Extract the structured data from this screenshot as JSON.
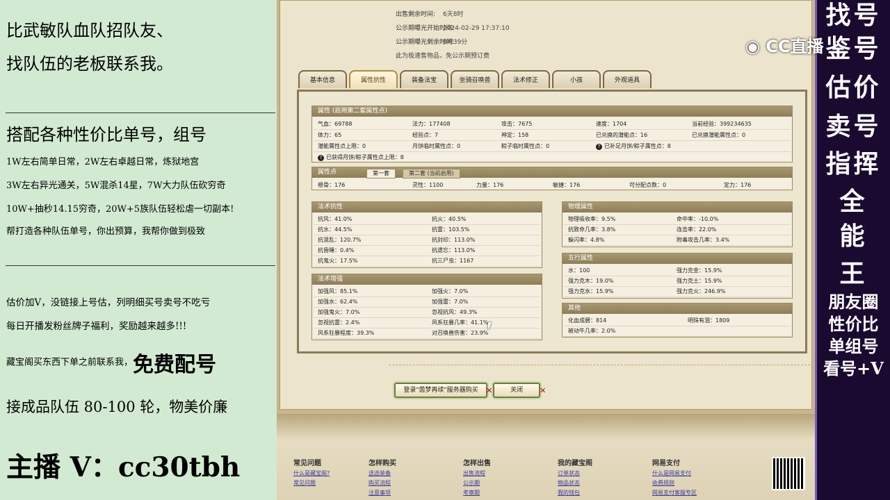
{
  "left_panel": {
    "line1": "比武敏队血队招队友、",
    "line2": "找队伍的老板联系我。",
    "heading2": "搭配各种性价比单号，组号",
    "p1": "1W左右简单日常，2W左右卓越日常，炼狱地宫",
    "p2": "3W左右异光通关，5W混杀14星，7W大力队伍砍穷奇",
    "p3": "10W+抽秒14.15穷奇，20W+5族队伍轻松虐一切副本!",
    "p4": "帮打造各种队伍单号，你出预算，我帮你做到极致",
    "p5": "估价加V，没链接上号估，列明细买号卖号不吃亏",
    "p6": "每日开播发粉丝牌子福利，奖励越来越多!!!",
    "p7a": "藏宝阁买东西下单之前联系我，",
    "p7b": "免费配号",
    "p8": "接成品队伍 80-100 轮，物美价廉",
    "contact": "主播 V：cc30tbh"
  },
  "right_panel": {
    "big": [
      "找号",
      "鉴号",
      "估价",
      "卖号",
      "指挥",
      "全",
      "能",
      "王"
    ],
    "small": [
      "朋友圈",
      "性价比",
      "单组号",
      "看号+V"
    ]
  },
  "logo": "CC直播",
  "top_info": [
    {
      "label": "出售剩余时间:",
      "value": "6天8时"
    },
    {
      "label": "公示期曝光开始时间:",
      "value": "2024-02-29 17:37:10"
    },
    {
      "label": "公示期曝光剩余时间:",
      "value": "8时39分"
    },
    {
      "label": "此为极速售物品，免公示期预订费",
      "value": ""
    }
  ],
  "tabs": [
    "基本信息",
    "属性抗性",
    "装备法宝",
    "坐骑召唤兽",
    "法术修正",
    "小孩",
    "外观道具"
  ],
  "attr_section": {
    "header": "属性 (启用第二套属性点)",
    "rows": [
      [
        "气血：69788",
        "法力：177408",
        "攻击：7675",
        "速度：1704",
        "当前经验：399234635"
      ],
      [
        "体力：65",
        "经验点：7",
        "神定：158",
        "已兑换的潜能点：16",
        "已兑换潜能属性点：0"
      ],
      [
        "潜能属性点上限：0",
        "月饼临时属性点：0",
        "粽子临时属性点：0",
        "已补足月饼/粽子属性点：8",
        ""
      ],
      [
        "已获得月饼/粽子属性点上限：8",
        "",
        "",
        "",
        ""
      ]
    ]
  },
  "points_section": {
    "header": "属性点",
    "tab1": "第一套",
    "tab2": "第二套 (当前启用)",
    "row": [
      "根骨：176",
      "灵性：1100",
      "力量：176",
      "敏捷：176",
      "可分配点数：0",
      "定力：176"
    ]
  },
  "resist_section": {
    "header": "法术抗性",
    "rows": [
      [
        "抗风：41.0%",
        "抗火：40.5%"
      ],
      [
        "抗水：44.5%",
        "抗雷：103.5%"
      ],
      [
        "抗混乱：120.7%",
        "抗封印：113.0%"
      ],
      [
        "抗昏睡：0.4%",
        "抗遗忘：113.0%"
      ],
      [
        "抗鬼火：17.5%",
        "抗三尸虫：1167"
      ]
    ]
  },
  "enhance_section": {
    "header": "法术增强",
    "rows": [
      [
        "加强风：85.1%",
        "加强火：7.0%"
      ],
      [
        "加强水：62.4%",
        "加强雷：7.0%"
      ],
      [
        "加强鬼火：7.0%",
        "忽视抗风：49.3%"
      ],
      [
        "忽视抗雷：2.4%",
        "风系狂暴几率：41.1%"
      ],
      [
        "风系狂暴程度：39.3%",
        "对召唤兽伤害：23.9%"
      ]
    ]
  },
  "physical_section": {
    "header": "物理属性",
    "rows": [
      [
        "物理吸收率：9.5%",
        "命中率：-10.0%"
      ],
      [
        "抗致命几率：3.8%",
        "连击率：22.0%"
      ],
      [
        "躲闪率：4.8%",
        "附毒攻击几率：3.4%"
      ]
    ]
  },
  "wuxing_section": {
    "header": "五行属性",
    "rows": [
      [
        "水：100",
        "强力克金：15.9%"
      ],
      [
        "强力克木：19.0%",
        "强力克土：15.9%"
      ],
      [
        "强力克水：15.9%",
        "强力克火：246.9%"
      ]
    ]
  },
  "other_section": {
    "header": "其他",
    "rows": [
      [
        "化血成碧：814",
        "明珠有泪：1809"
      ],
      [
        "被动牛几率：2.0%",
        ""
      ]
    ]
  },
  "buttons": {
    "login": "登录\"茵梦再续\"服务器购买",
    "close": "关闭"
  },
  "footer": {
    "cols": [
      {
        "title": "常见问题",
        "links": [
          "什么是藏宝阁?",
          "常见问题"
        ]
      },
      {
        "title": "怎样购买",
        "links": [
          "选选装备",
          "购买流程",
          "注意事项"
        ]
      },
      {
        "title": "怎样出售",
        "links": [
          "出售流程",
          "公示期",
          "考察期"
        ]
      },
      {
        "title": "我的藏宝阁",
        "links": [
          "订单状态",
          "物品状态",
          "我的钱包"
        ]
      },
      {
        "title": "网易支付",
        "links": [
          "什么是网易支付",
          "收费规则",
          "网易支付客服专区"
        ]
      }
    ]
  }
}
